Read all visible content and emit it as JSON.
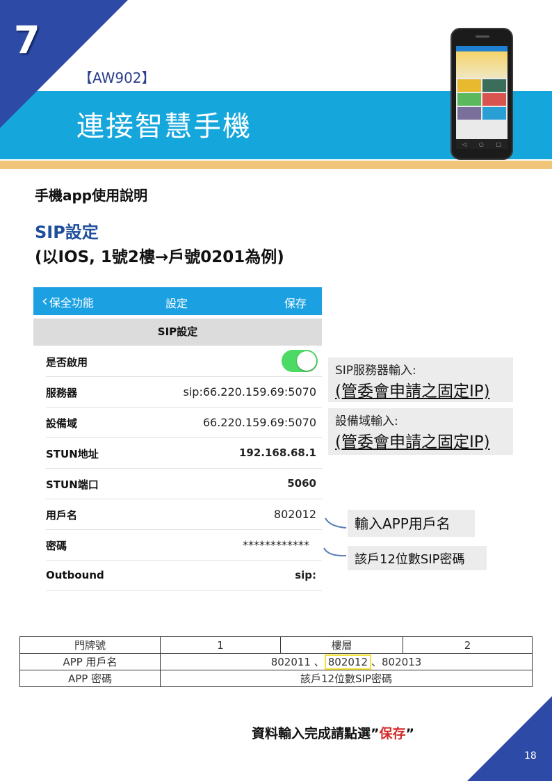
{
  "header": {
    "chapter_number": "7",
    "model_tag": "【AW902】",
    "title": "連接智慧手機"
  },
  "colors": {
    "primary_blue": "#2d4aa6",
    "band_cyan": "#15a6dc",
    "accent_gold": "#f0c479",
    "app_nav_blue": "#1ba1e2",
    "toggle_green": "#4cd964",
    "highlight_yellow": "#f2e23a",
    "save_red": "#d32a2a"
  },
  "intro": {
    "heading": "手機app使用說明",
    "sip_title": "SIP設定",
    "sip_subtitle": "(以IOS, 1號2樓→戶號0201為例)"
  },
  "app": {
    "nav": {
      "back_icon": "chevron-left-icon",
      "back_label": "保全功能",
      "title": "設定",
      "save_label": "保存"
    },
    "section_title": "SIP設定",
    "rows": [
      {
        "label": "是否啟用",
        "value": "",
        "type": "toggle",
        "on": true
      },
      {
        "label": "服務器",
        "value": "sip:66.220.159.69:5070"
      },
      {
        "label": "設備域",
        "value": "66.220.159.69:5070"
      },
      {
        "label": "STUN地址",
        "value": "192.168.68.1"
      },
      {
        "label": "STUN端口",
        "value": "5060"
      },
      {
        "label": "用戶名",
        "value": "802012"
      },
      {
        "label": "密碼",
        "value": "************"
      },
      {
        "label": "Outbound",
        "value": "sip:"
      }
    ]
  },
  "callouts": {
    "server_small": "SIP服務器輸入:",
    "server_big": "(管委會申請之固定IP)",
    "domain_small": "設備域輸入:",
    "domain_big": "(管委會申請之固定IP)",
    "username": "輸入APP用戶名",
    "password": "該戶12位數SIP密碼"
  },
  "table": {
    "row1": {
      "label": "門牌號",
      "door": "1",
      "floor_label": "樓層",
      "floor": "2"
    },
    "row2": {
      "label": "APP 用戶名",
      "pre": "802011 、",
      "highlighted": "802012",
      "post": "、802013"
    },
    "row3": {
      "label": "APP 密碼",
      "value": "該戶12位數SIP密碼"
    }
  },
  "footer": {
    "note_prefix": "資料輸入完成請點選”",
    "note_highlight": "保存",
    "note_suffix": "”",
    "page_number": "18"
  }
}
